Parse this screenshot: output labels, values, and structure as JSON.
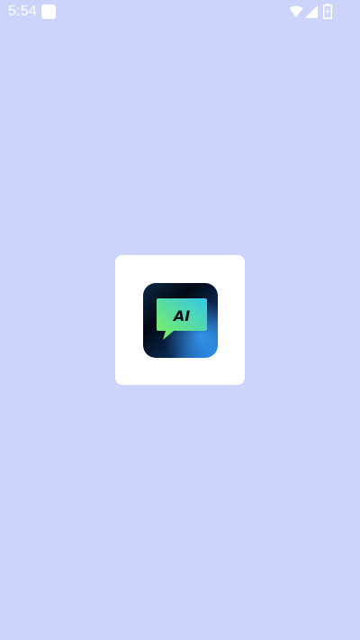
{
  "status_bar": {
    "time": "5:54",
    "icons": [
      "notification-icon",
      "wifi-icon",
      "cellular-signal-icon",
      "battery-icon"
    ],
    "color": "#ffffff"
  },
  "splash": {
    "background_color": "#cdd4fb",
    "card_color": "#ffffff",
    "logo": {
      "icon": "ai-chat-bubble-logo",
      "text": "AI",
      "bubble_gradient": [
        "#7ef25a",
        "#35c7e8"
      ],
      "tile_gradient": [
        "#041526",
        "#1f7fe6"
      ]
    }
  }
}
